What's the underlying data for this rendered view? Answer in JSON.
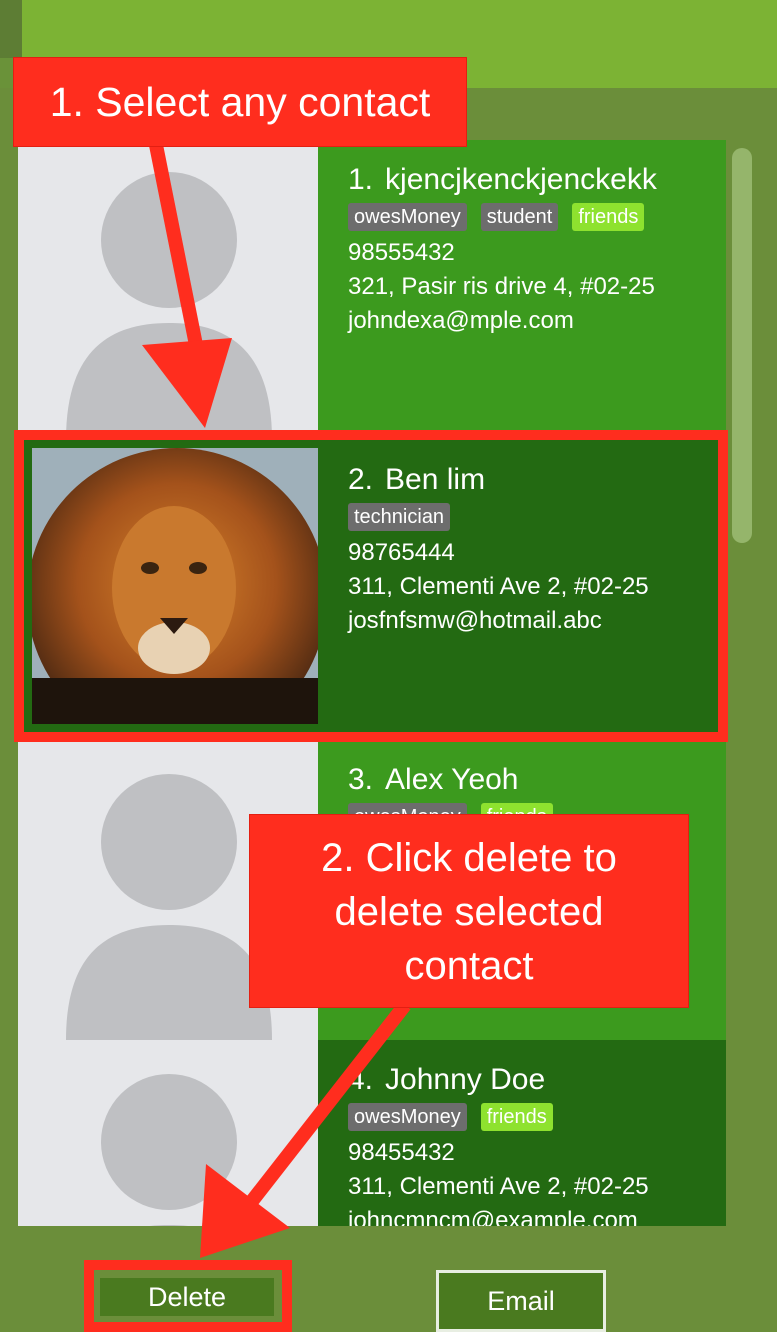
{
  "contacts": [
    {
      "index": "1.",
      "name": "kjencjkenckjenckekk",
      "tags": [
        "owesMoney",
        "student",
        "friends"
      ],
      "phone": "98555432",
      "address": "321, Pasir ris drive 4, #02-25",
      "email": "johndexa@mple.com"
    },
    {
      "index": "2.",
      "name": "Ben lim",
      "tags": [
        "technician"
      ],
      "phone": "98765444",
      "address": "311, Clementi Ave 2, #02-25",
      "email": "josfnfsmw@hotmail.abc"
    },
    {
      "index": "3.",
      "name": "Alex Yeoh",
      "tags": [
        "owesMoney",
        "friends"
      ],
      "phone": "",
      "address": "",
      "email": ""
    },
    {
      "index": "4.",
      "name": "Johnny Doe",
      "tags": [
        "owesMoney",
        "friends"
      ],
      "phone": "98455432",
      "address": "311, Clementi Ave 2, #02-25",
      "email": "johncmncm@example.com"
    }
  ],
  "buttons": {
    "delete": "Delete",
    "email": "Email"
  },
  "annotations": {
    "step1": "1. Select any contact",
    "step2": "2. Click delete to delete selected contact"
  },
  "colors": {
    "annotation": "#ff2d1e",
    "card_light": "#3c9a1e",
    "card_dark": "#236a12",
    "tag_friends": "#8ee22f",
    "tag_default": "#6d6d6d"
  },
  "icons": {
    "placeholder_avatar": "person-placeholder-icon",
    "contact2_photo": "lion-photo"
  }
}
